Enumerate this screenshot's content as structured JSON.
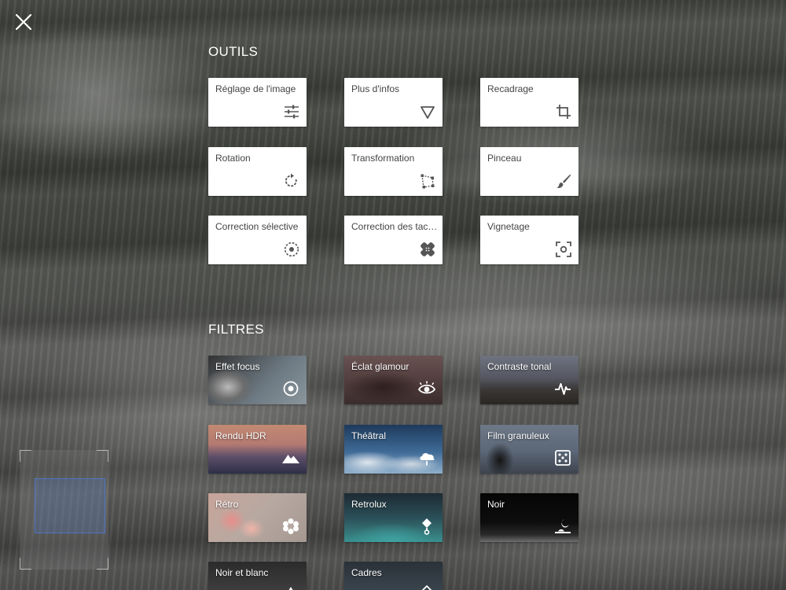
{
  "sections": {
    "tools_title": "OUTILS",
    "filters_title": "FILTRES"
  },
  "tools": [
    {
      "label": "Réglage de l'image",
      "icon": "sliders-icon"
    },
    {
      "label": "Plus d'infos",
      "icon": "triangle-down-icon"
    },
    {
      "label": "Recadrage",
      "icon": "crop-icon"
    },
    {
      "label": "Rotation",
      "icon": "rotate-icon"
    },
    {
      "label": "Transformation",
      "icon": "perspective-icon"
    },
    {
      "label": "Pinceau",
      "icon": "brush-icon"
    },
    {
      "label": "Correction sélective",
      "icon": "selective-target-icon"
    },
    {
      "label": "Correction des tach...",
      "icon": "bandage-icon"
    },
    {
      "label": "Vignetage",
      "icon": "vignette-icon"
    }
  ],
  "filters": [
    {
      "label": "Effet focus",
      "icon": "focus-target-icon"
    },
    {
      "label": "Éclat glamour",
      "icon": "eye-icon"
    },
    {
      "label": "Contraste tonal",
      "icon": "pulse-icon"
    },
    {
      "label": "Rendu HDR",
      "icon": "mountain-icon"
    },
    {
      "label": "Théâtral",
      "icon": "storm-cloud-icon"
    },
    {
      "label": "Film granuleux",
      "icon": "dice-icon"
    },
    {
      "label": "Rétro",
      "icon": "flower-icon"
    },
    {
      "label": "Retrolux",
      "icon": "pin-icon"
    },
    {
      "label": "Noir",
      "icon": "moon-icon"
    },
    {
      "label": "Noir et blanc",
      "icon": "mountain-bw-icon"
    },
    {
      "label": "Cadres",
      "icon": "frame-icon"
    }
  ]
}
